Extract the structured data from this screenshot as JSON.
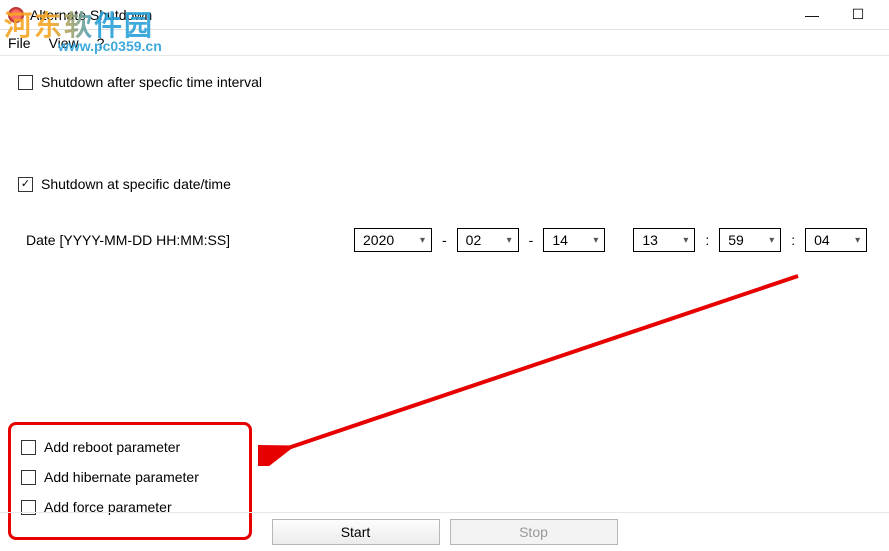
{
  "window": {
    "title": "Alternate Shutdown"
  },
  "menu": {
    "file": "File",
    "view": "View",
    "help": "?"
  },
  "watermark": {
    "text": "河东软件园",
    "url": "www.pc0359.cn"
  },
  "options": {
    "interval_label": "Shutdown after specfic time interval",
    "datetime_label": "Shutdown at specific date/time"
  },
  "date": {
    "label": "Date [YYYY-MM-DD HH:MM:SS]",
    "year": "2020",
    "month": "02",
    "day": "14",
    "hour": "13",
    "minute": "59",
    "second": "04",
    "dash": "-",
    "colon": ":"
  },
  "params": {
    "reboot": "Add reboot parameter",
    "hibernate": "Add hibernate parameter",
    "force": "Add force parameter"
  },
  "buttons": {
    "start": "Start",
    "stop": "Stop"
  },
  "winbtns": {
    "min": "—",
    "max": "☐"
  }
}
